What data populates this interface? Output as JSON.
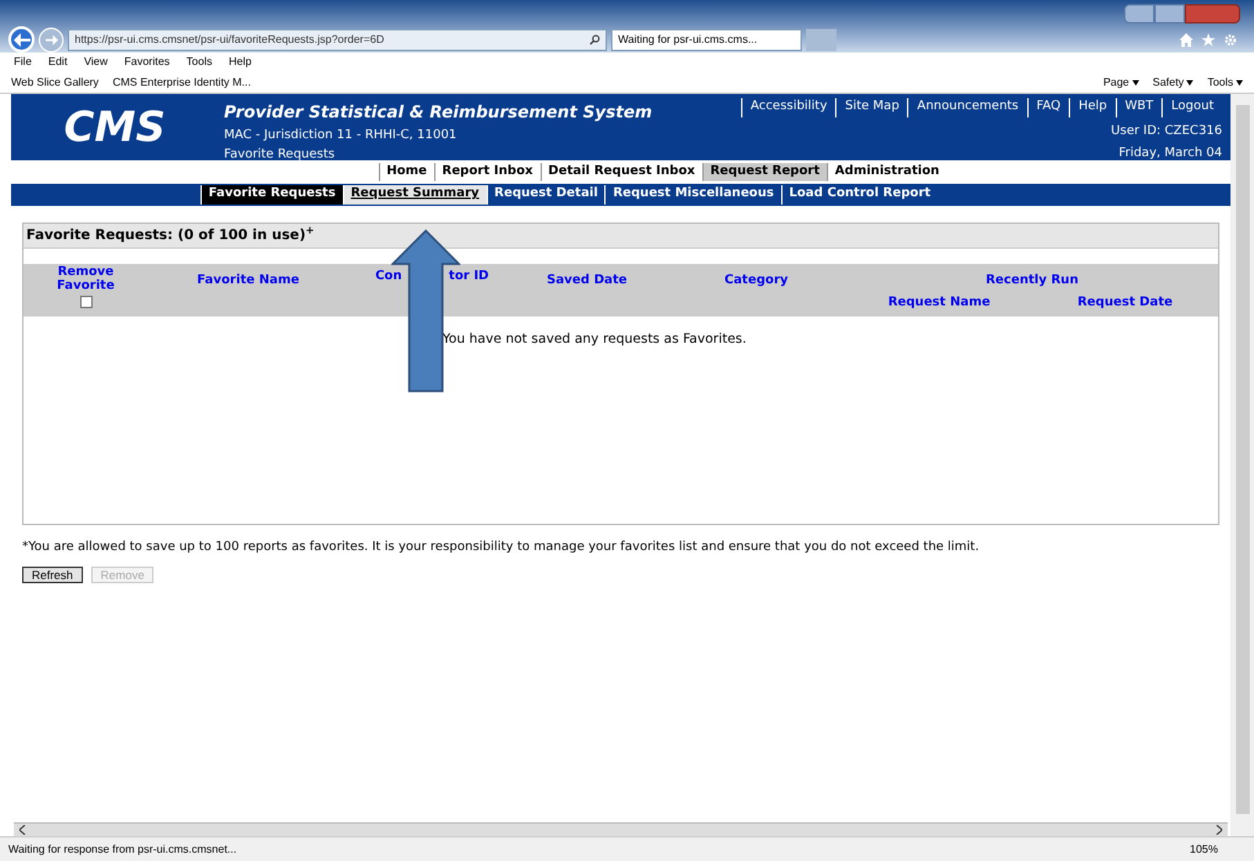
{
  "browser": {
    "url": "https://psr-ui.cms.cmsnet/psr-ui/favoriteRequests.jsp?order=6D",
    "tab": "Waiting for psr-ui.cms.cms...",
    "menu": [
      "File",
      "Edit",
      "View",
      "Favorites",
      "Tools",
      "Help"
    ],
    "favorites": [
      "Web Slice Gallery",
      "CMS Enterprise Identity M..."
    ],
    "commands": [
      "Page",
      "Safety",
      "Tools"
    ]
  },
  "header": {
    "logo": "CMS",
    "title": "Provider Statistical & Reimbursement System",
    "subtitle": "MAC - Jurisdiction 11 - RHHI-C, 11001",
    "page": "Favorite Requests",
    "links": [
      "Accessibility",
      "Site Map",
      "Announcements",
      "FAQ",
      "Help",
      "WBT",
      "Logout"
    ],
    "user": "User ID: CZEC316",
    "date": "Friday, March 04"
  },
  "nav": [
    {
      "label": "Home",
      "selected": false
    },
    {
      "label": "Report Inbox",
      "selected": false
    },
    {
      "label": "Detail Request Inbox",
      "selected": false
    },
    {
      "label": "Request Report",
      "selected": true
    },
    {
      "label": "Administration",
      "selected": false
    }
  ],
  "subnav": [
    {
      "label": "Favorite Requests",
      "selected": true,
      "hovered": false
    },
    {
      "label": "Request Summary",
      "selected": false,
      "hovered": true
    },
    {
      "label": "Request Detail",
      "selected": false,
      "hovered": false
    },
    {
      "label": "Request Miscellaneous",
      "selected": false,
      "hovered": false
    },
    {
      "label": "Load Control Report",
      "selected": false,
      "hovered": false
    }
  ],
  "panel": {
    "title": "Favorite Requests: (0 of 100 in use)$^{+}$",
    "columns": {
      "remove": "Remove Favorite",
      "name": "Favorite Name",
      "contractor_parts": [
        "Con",
        "tor ID"
      ],
      "saved": "Saved Date",
      "category": "Category",
      "recent": "Recently Run",
      "request_name": "Request Name",
      "request_date": "Request Date"
    },
    "select_all": {
      "checked": false
    },
    "empty_message": "You have not saved any requests as Favorites."
  },
  "footnote": "*You are allowed to save up to 100 reports as favorites. It is your responsibility to manage your favorites list and ensure that you do not exceed the limit.",
  "buttons": [
    {
      "label": "Refresh",
      "disabled": false
    },
    {
      "label": "Remove",
      "disabled": true
    }
  ],
  "status": {
    "text": "Waiting for response from psr-ui.cms.cmsnet...",
    "zoom": "105%"
  }
}
